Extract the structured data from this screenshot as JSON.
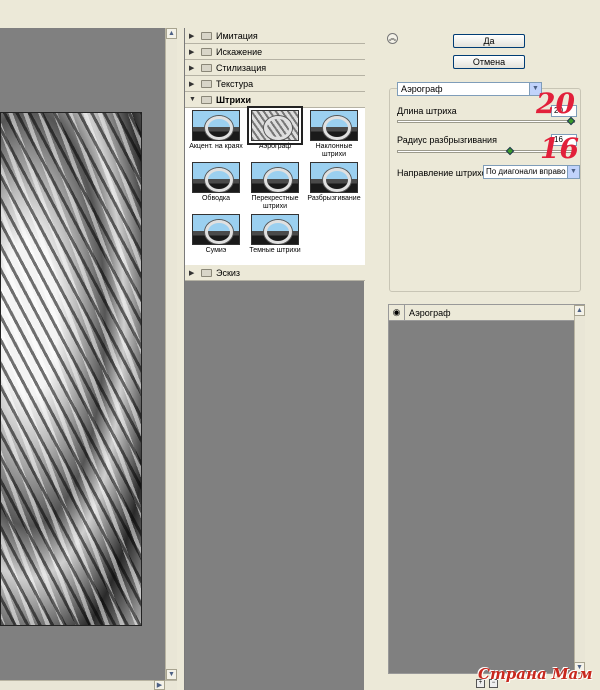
{
  "gallery": {
    "categories_top": [
      {
        "label": "Имитация"
      },
      {
        "label": "Искажение"
      },
      {
        "label": "Стилизация"
      },
      {
        "label": "Текстура"
      }
    ],
    "open_category": "Штрихи",
    "thumbnails": [
      {
        "label": "Акцент. на краях"
      },
      {
        "label": "Аэрограф"
      },
      {
        "label": "Наклонные штрихи"
      },
      {
        "label": "Обводка"
      },
      {
        "label": "Перекрестные штрихи"
      },
      {
        "label": "Разбрызгивание"
      },
      {
        "label": "Сумиэ"
      },
      {
        "label": "Темные штрихи"
      }
    ],
    "selected_thumbnail": "Аэрограф",
    "categories_bottom": [
      {
        "label": "Эскиз"
      }
    ]
  },
  "dialog": {
    "ok_label": "Да",
    "cancel_label": "Отмена"
  },
  "settings": {
    "filter_select": "Аэрограф",
    "stroke_length_label": "Длина штриха",
    "stroke_length_value": "20",
    "stroke_length_fraction": 1.0,
    "spray_radius_label": "Радиус разбрызгивания",
    "spray_radius_value": "16",
    "spray_radius_fraction": 0.64,
    "direction_label": "Направление штрихов:",
    "direction_value": "По диагонали вправо",
    "handwritten_1": "20",
    "handwritten_2": "16"
  },
  "layers": {
    "items": [
      {
        "name": "Аэрограф"
      }
    ]
  },
  "watermark": "Страна Мам",
  "icons": {
    "expand": "triangle-right-icon",
    "collapse": "triangle-down-icon",
    "folder": "folder-icon",
    "eye": "eye-icon"
  }
}
